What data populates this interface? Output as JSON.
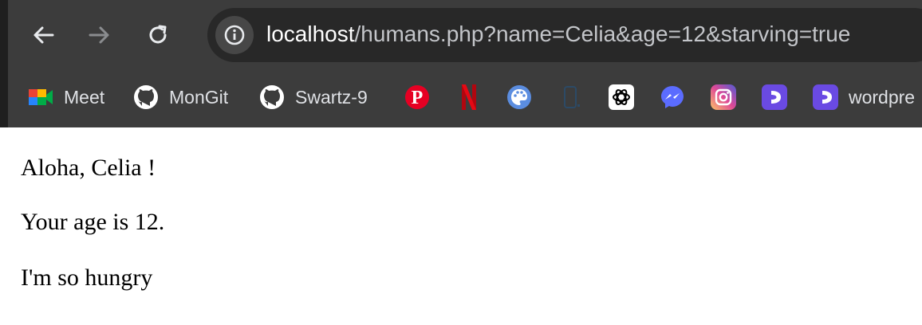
{
  "browser": {
    "url_host": "localhost",
    "url_path": "/humans.php?name=Celia&age=12&starving=true",
    "bookmarks": [
      {
        "label": "Meet",
        "icon": "google-meet-icon"
      },
      {
        "label": "MonGit",
        "icon": "github-icon"
      },
      {
        "label": "Swartz-9",
        "icon": "github-icon"
      },
      {
        "label": "",
        "icon": "pinterest-icon"
      },
      {
        "label": "",
        "icon": "netflix-icon"
      },
      {
        "label": "",
        "icon": "palette-icon"
      },
      {
        "label": "",
        "icon": "phone-icon"
      },
      {
        "label": "",
        "icon": "openai-icon"
      },
      {
        "label": "",
        "icon": "messenger-icon"
      },
      {
        "label": "",
        "icon": "instagram-icon"
      },
      {
        "label": "",
        "icon": "dropcontact-icon"
      },
      {
        "label": "wordpre",
        "icon": "dropcontact-icon"
      }
    ],
    "colors": {
      "chrome_bg": "#3c3c3c",
      "omnibox_bg": "#282828"
    }
  },
  "page": {
    "greeting": "Aloha, Celia !",
    "age_text": "Your age is 12.",
    "hunger_text": "I'm so hungry"
  }
}
